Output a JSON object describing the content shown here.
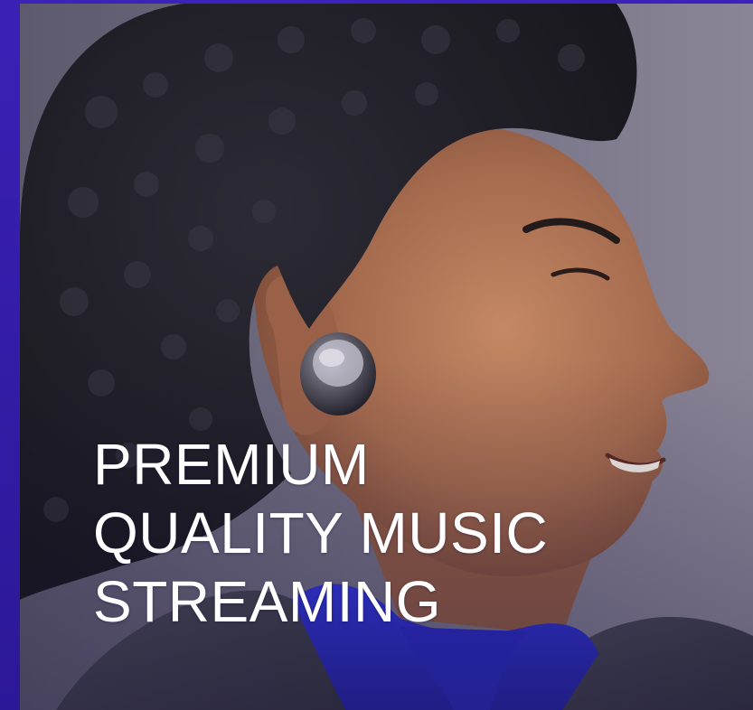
{
  "hero": {
    "headline_lines": [
      "PREMIUM",
      "QUALITY MUSIC",
      "STREAMING"
    ],
    "image_alt": "Man wearing a wireless earbud, smiling in profile"
  },
  "colors": {
    "frame_purple": "#3a1fb0",
    "text": "#ffffff",
    "shirt_blue": "#2b2fd6",
    "earbud": "#2a2a30",
    "skin": "#a86a4c",
    "hair": "#1e1c24",
    "background": "#6b6679"
  },
  "icons": {
    "earbud": "earbud-icon"
  }
}
